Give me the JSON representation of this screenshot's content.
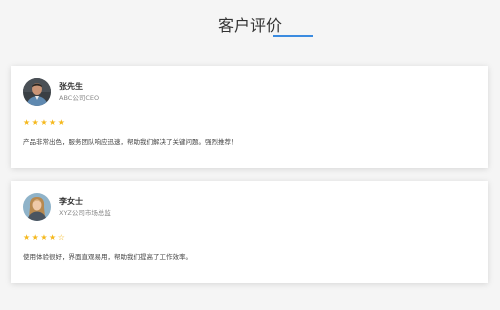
{
  "section": {
    "title": "客户评价",
    "accent_color": "#3b8be0"
  },
  "testimonials": [
    {
      "name": "张先生",
      "role": "ABC公司CEO",
      "stars": "★★★★★",
      "rating": 5,
      "text": "产品非常出色，服务团队响应迅速，帮助我们解决了关键问题。强烈推荐！",
      "avatar_icon": "man-avatar"
    },
    {
      "name": "李女士",
      "role": "XYZ公司市场总监",
      "stars": "★★★★☆",
      "rating": 4,
      "text": "使用体验很好，界面直观易用，帮助我们提高了工作效率。",
      "avatar_icon": "woman-avatar"
    }
  ],
  "colors": {
    "star": "#f5b81c",
    "card_bg": "#ffffff",
    "page_bg": "#f5f5f5"
  }
}
